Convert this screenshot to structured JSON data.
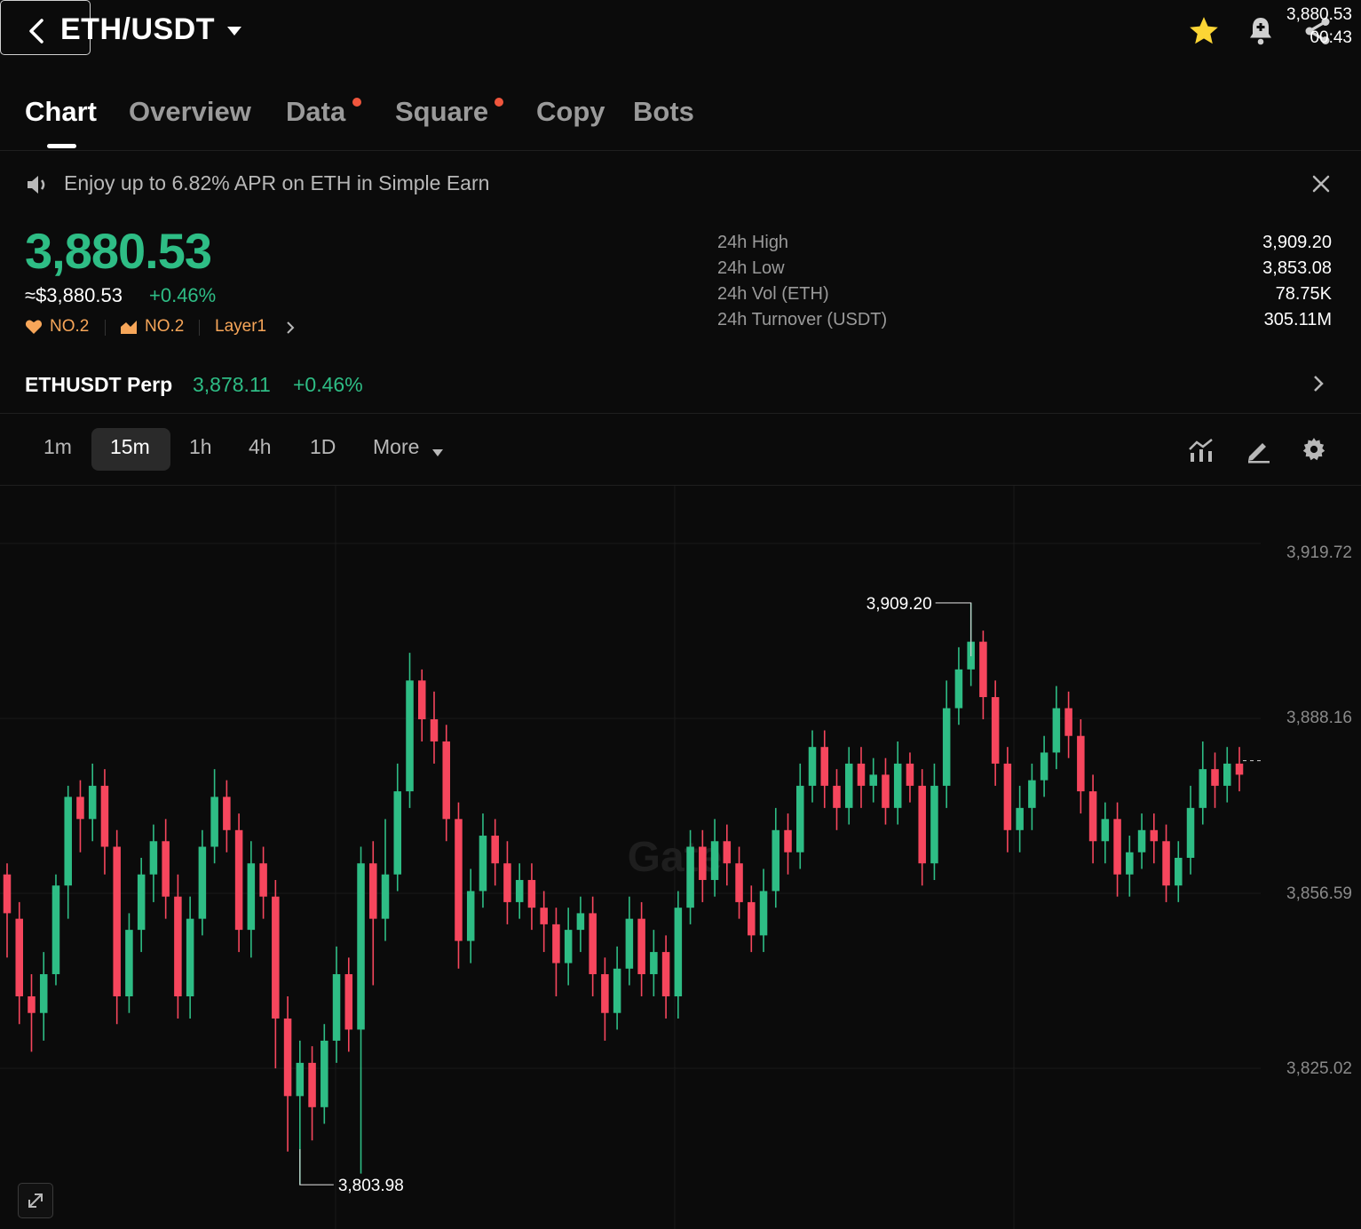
{
  "header": {
    "title": "ETH/USDT"
  },
  "tabs": [
    {
      "label": "Chart",
      "active": true
    },
    {
      "label": "Overview"
    },
    {
      "label": "Data",
      "dot": true
    },
    {
      "label": "Square",
      "dot": true
    },
    {
      "label": "Copy"
    },
    {
      "label": "Bots"
    }
  ],
  "banner": {
    "text": "Enjoy up to 6.82% APR on ETH in Simple Earn"
  },
  "ticker": {
    "price": "3,880.53",
    "usd_price": "≈$3,880.53",
    "change": "+0.46%",
    "tags": [
      {
        "label": "NO.2",
        "icon": "heart-icon"
      },
      {
        "label": "NO.2",
        "icon": "trend-icon"
      },
      {
        "label": "Layer1"
      }
    ]
  },
  "stats": [
    {
      "label": "24h High",
      "value": "3,909.20"
    },
    {
      "label": "24h Low",
      "value": "3,853.08"
    },
    {
      "label": "24h Vol (ETH)",
      "value": "78.75K"
    },
    {
      "label": "24h Turnover (USDT)",
      "value": "305.11M"
    }
  ],
  "perp": {
    "name": "ETHUSDT Perp",
    "price": "3,878.11",
    "change": "+0.46%"
  },
  "timeframes": [
    {
      "label": "1m"
    },
    {
      "label": "15m",
      "active": true
    },
    {
      "label": "1h"
    },
    {
      "label": "4h"
    },
    {
      "label": "1D"
    },
    {
      "label": "More"
    }
  ],
  "colors": {
    "up": "#2ebd85",
    "down": "#f6465d",
    "accent": "#f7a659",
    "star": "#fcd535"
  },
  "chart_data": {
    "type": "candlestick",
    "y_ticks": [
      "3,919.72",
      "3,888.16",
      "3,856.59",
      "3,825.02"
    ],
    "tick_values": [
      3919.72,
      3888.16,
      3856.59,
      3825.02
    ],
    "high_label": "3,909.20",
    "low_label": "3,803.98",
    "last_price": "3,880.53",
    "countdown": "00:43",
    "watermark": "Gate",
    "candles": [
      [
        3860,
        3853,
        3862,
        3845
      ],
      [
        3852,
        3838,
        3855,
        3833
      ],
      [
        3838,
        3835,
        3842,
        3828
      ],
      [
        3835,
        3842,
        3846,
        3830
      ],
      [
        3842,
        3858,
        3860,
        3840
      ],
      [
        3858,
        3874,
        3876,
        3852
      ],
      [
        3874,
        3870,
        3877,
        3864
      ],
      [
        3870,
        3876,
        3880,
        3866
      ],
      [
        3876,
        3865,
        3879,
        3860
      ],
      [
        3865,
        3838,
        3868,
        3833
      ],
      [
        3838,
        3850,
        3853,
        3835
      ],
      [
        3850,
        3860,
        3863,
        3846
      ],
      [
        3860,
        3866,
        3869,
        3855
      ],
      [
        3866,
        3856,
        3870,
        3852
      ],
      [
        3856,
        3838,
        3860,
        3834
      ],
      [
        3838,
        3852,
        3856,
        3834
      ],
      [
        3852,
        3865,
        3868,
        3849
      ],
      [
        3865,
        3874,
        3879,
        3862
      ],
      [
        3874,
        3868,
        3877,
        3864
      ],
      [
        3868,
        3850,
        3871,
        3846
      ],
      [
        3850,
        3862,
        3866,
        3845
      ],
      [
        3862,
        3856,
        3865,
        3852
      ],
      [
        3856,
        3834,
        3859,
        3825
      ],
      [
        3834,
        3820,
        3838,
        3810
      ],
      [
        3820,
        3826,
        3830,
        3804
      ],
      [
        3826,
        3818,
        3829,
        3812
      ],
      [
        3818,
        3830,
        3833,
        3815
      ],
      [
        3830,
        3842,
        3847,
        3826
      ],
      [
        3842,
        3832,
        3845,
        3828
      ],
      [
        3832,
        3862,
        3865,
        3806
      ],
      [
        3862,
        3852,
        3866,
        3840
      ],
      [
        3852,
        3860,
        3870,
        3848
      ],
      [
        3860,
        3875,
        3880,
        3857
      ],
      [
        3875,
        3895,
        3900,
        3872
      ],
      [
        3895,
        3888,
        3897,
        3884
      ],
      [
        3888,
        3884,
        3893,
        3880
      ],
      [
        3884,
        3870,
        3887,
        3866
      ],
      [
        3870,
        3848,
        3873,
        3843
      ],
      [
        3848,
        3857,
        3861,
        3844
      ],
      [
        3857,
        3867,
        3871,
        3854
      ],
      [
        3867,
        3862,
        3870,
        3858
      ],
      [
        3862,
        3855,
        3866,
        3851
      ],
      [
        3855,
        3859,
        3862,
        3852
      ],
      [
        3859,
        3854,
        3862,
        3850
      ],
      [
        3854,
        3851,
        3857,
        3846
      ],
      [
        3851,
        3844,
        3854,
        3838
      ],
      [
        3844,
        3850,
        3854,
        3840
      ],
      [
        3850,
        3853,
        3856,
        3846
      ],
      [
        3853,
        3842,
        3856,
        3838
      ],
      [
        3842,
        3835,
        3845,
        3830
      ],
      [
        3835,
        3843,
        3847,
        3832
      ],
      [
        3843,
        3852,
        3856,
        3840
      ],
      [
        3852,
        3842,
        3855,
        3838
      ],
      [
        3842,
        3846,
        3850,
        3838
      ],
      [
        3846,
        3838,
        3849,
        3834
      ],
      [
        3838,
        3854,
        3857,
        3834
      ],
      [
        3854,
        3865,
        3868,
        3851
      ],
      [
        3865,
        3859,
        3868,
        3855
      ],
      [
        3859,
        3866,
        3870,
        3856
      ],
      [
        3866,
        3862,
        3869,
        3858
      ],
      [
        3862,
        3855,
        3865,
        3852
      ],
      [
        3855,
        3849,
        3858,
        3846
      ],
      [
        3849,
        3857,
        3861,
        3846
      ],
      [
        3857,
        3868,
        3872,
        3854
      ],
      [
        3868,
        3864,
        3871,
        3860
      ],
      [
        3864,
        3876,
        3880,
        3861
      ],
      [
        3876,
        3883,
        3886,
        3873
      ],
      [
        3883,
        3876,
        3886,
        3872
      ],
      [
        3876,
        3872,
        3879,
        3868
      ],
      [
        3872,
        3880,
        3883,
        3869
      ],
      [
        3880,
        3876,
        3883,
        3872
      ],
      [
        3876,
        3878,
        3881,
        3873
      ],
      [
        3878,
        3872,
        3881,
        3869
      ],
      [
        3872,
        3880,
        3884,
        3869
      ],
      [
        3880,
        3876,
        3882,
        3873
      ],
      [
        3876,
        3862,
        3879,
        3858
      ],
      [
        3862,
        3876,
        3880,
        3859
      ],
      [
        3876,
        3890,
        3895,
        3872
      ],
      [
        3890,
        3897,
        3901,
        3887
      ],
      [
        3897,
        3902,
        3909,
        3894
      ],
      [
        3902,
        3892,
        3904,
        3888
      ],
      [
        3892,
        3880,
        3895,
        3876
      ],
      [
        3880,
        3868,
        3883,
        3864
      ],
      [
        3868,
        3872,
        3876,
        3864
      ],
      [
        3872,
        3877,
        3880,
        3868
      ],
      [
        3877,
        3882,
        3885,
        3874
      ],
      [
        3882,
        3890,
        3894,
        3879
      ],
      [
        3890,
        3885,
        3893,
        3881
      ],
      [
        3885,
        3875,
        3888,
        3871
      ],
      [
        3875,
        3866,
        3878,
        3862
      ],
      [
        3866,
        3870,
        3873,
        3862
      ],
      [
        3870,
        3860,
        3873,
        3856
      ],
      [
        3860,
        3864,
        3867,
        3856
      ],
      [
        3864,
        3868,
        3871,
        3861
      ],
      [
        3868,
        3866,
        3871,
        3862
      ],
      [
        3866,
        3858,
        3869,
        3855
      ],
      [
        3858,
        3863,
        3866,
        3855
      ],
      [
        3863,
        3872,
        3876,
        3860
      ],
      [
        3872,
        3879,
        3884,
        3869
      ],
      [
        3879,
        3876,
        3882,
        3872
      ],
      [
        3876,
        3880,
        3883,
        3873
      ],
      [
        3880,
        3878,
        3883,
        3875
      ]
    ]
  }
}
